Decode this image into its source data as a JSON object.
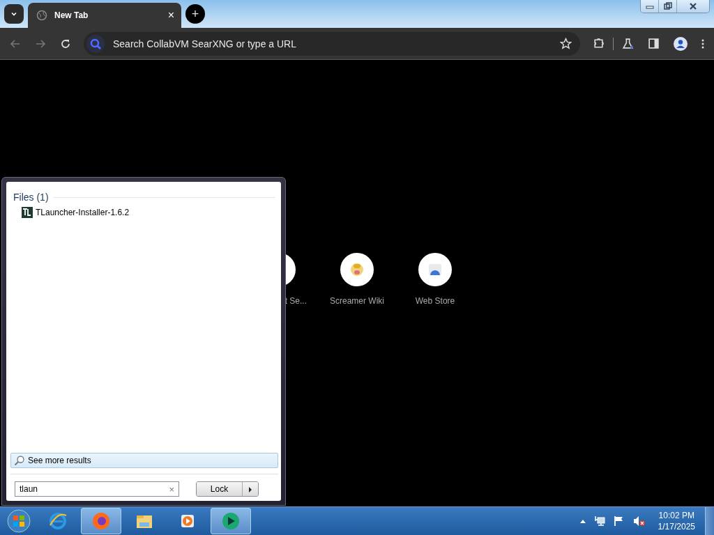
{
  "browser": {
    "tab": {
      "title": "New Tab",
      "close": "×",
      "selected": true
    },
    "new_tab": "+",
    "omnibox": {
      "placeholder": "Search CollabVM SearXNG or type a URL"
    }
  },
  "shortcuts": [
    {
      "label": "t Se...",
      "kind": "partial"
    },
    {
      "label": "Screamer Wiki",
      "kind": "screamer"
    },
    {
      "label": "Web Store",
      "kind": "store"
    }
  ],
  "start_menu": {
    "section": "Files (1)",
    "results": [
      {
        "name": "TLauncher-Installer-1.6.2"
      }
    ],
    "see_more": "See more results",
    "search": {
      "value": "tlaun",
      "clear": "×"
    },
    "power_button": "Lock"
  },
  "taskbar": {
    "apps": [
      {
        "kind": "ie",
        "active": false
      },
      {
        "kind": "firefox",
        "active": true
      },
      {
        "kind": "explorer",
        "active": false
      },
      {
        "kind": "media",
        "active": false
      },
      {
        "kind": "green",
        "active": true
      }
    ],
    "clock": {
      "time": "10:02 PM",
      "date": "1/17/2025"
    }
  }
}
